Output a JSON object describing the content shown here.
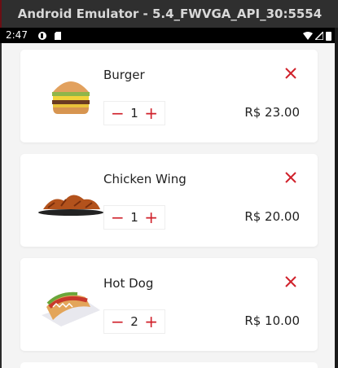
{
  "window": {
    "title": "Android Emulator - 5.4_FWVGA_API_30:5554"
  },
  "status_bar": {
    "time": "2:47"
  },
  "cart": {
    "items": [
      {
        "name": "Burger",
        "quantity": "1",
        "price": "R$ 23.00",
        "image": "burger"
      },
      {
        "name": "Chicken Wing",
        "quantity": "1",
        "price": "R$ 20.00",
        "image": "chicken-wings"
      },
      {
        "name": "Hot Dog",
        "quantity": "2",
        "price": "R$ 10.00",
        "image": "hot-dog"
      }
    ]
  },
  "colors": {
    "accent": "#d0212b"
  },
  "icons": {
    "decrease": "−",
    "increase": "+"
  }
}
